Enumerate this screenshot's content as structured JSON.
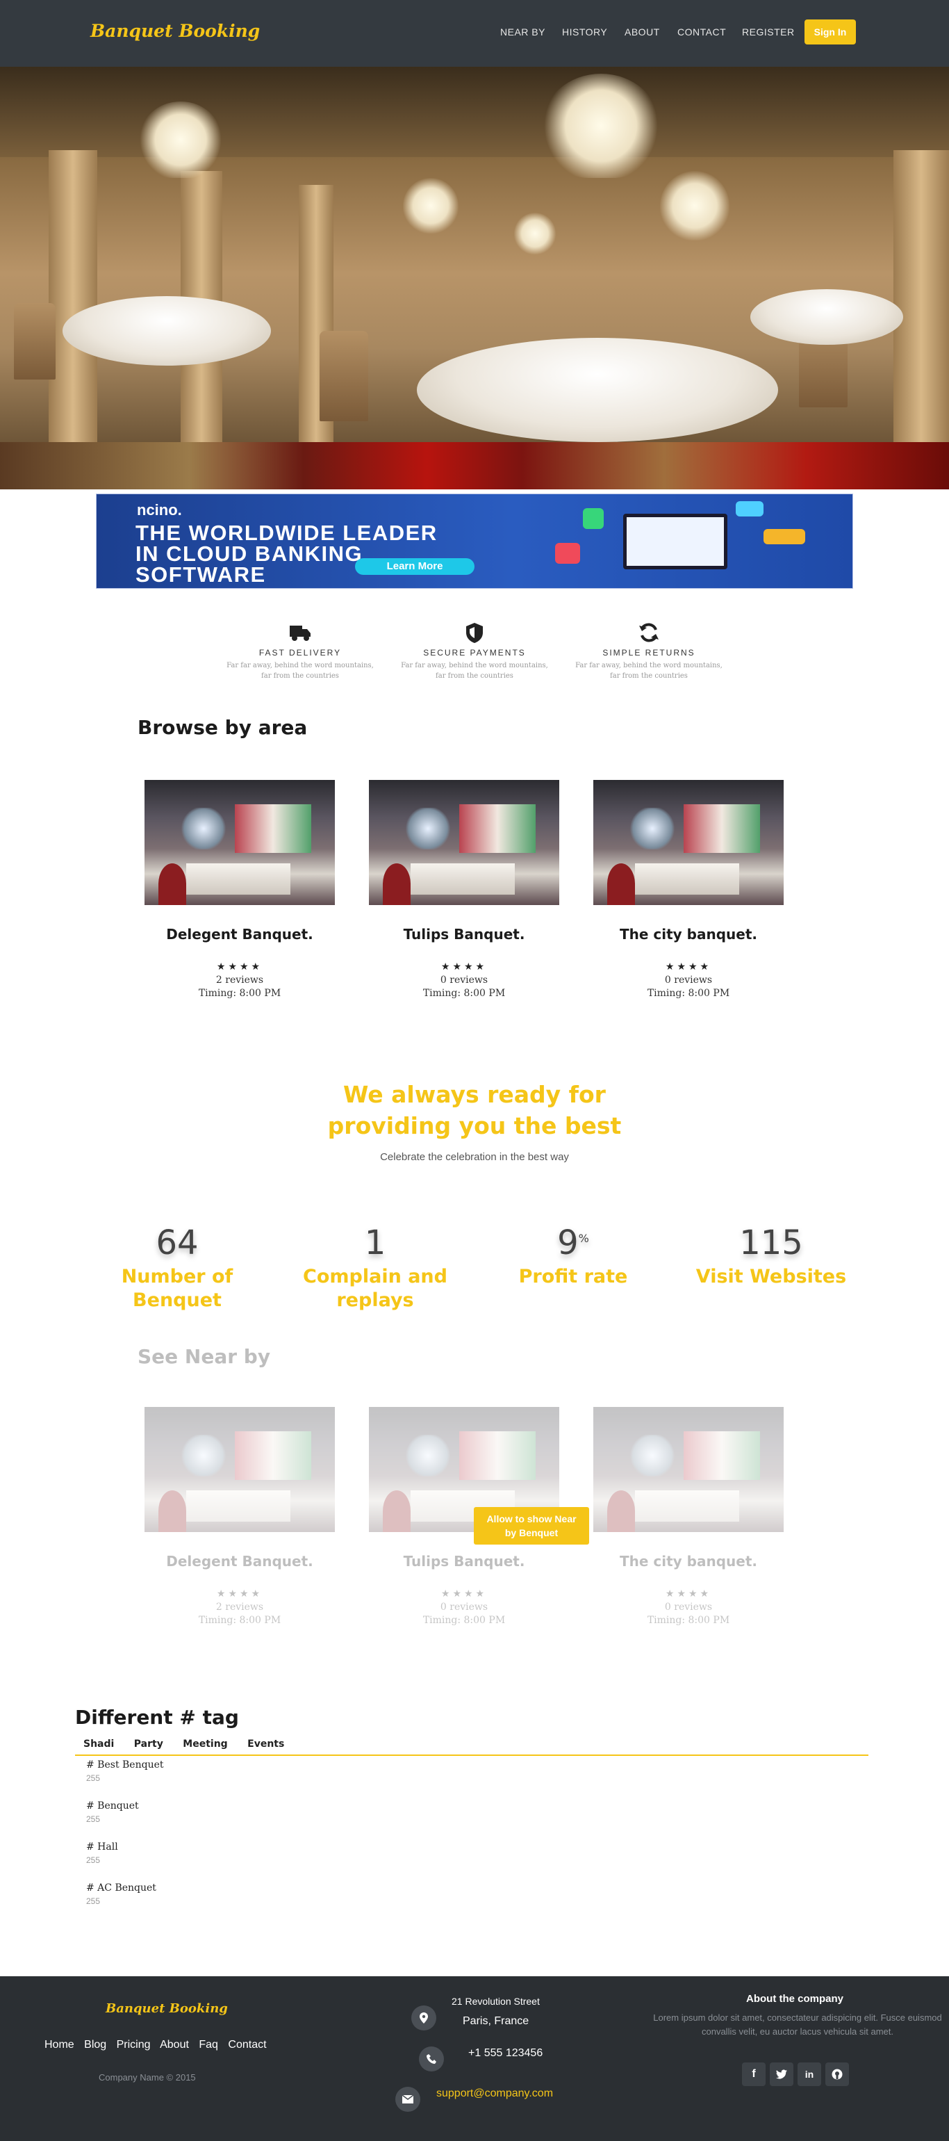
{
  "header": {
    "brand": "Banquet Booking",
    "nav": [
      "NEAR BY",
      "HISTORY",
      "ABOUT",
      "CONTACT",
      "REGISTER"
    ],
    "signin": "Sign In"
  },
  "ad": {
    "logo": "ncino.",
    "line1": "THE WORLDWIDE LEADER",
    "line2": "IN CLOUD BANKING",
    "line3": "SOFTWARE",
    "button": "Learn More"
  },
  "features": [
    {
      "title": "FAST DELIVERY",
      "desc": "Far far away, behind the word mountains, far from the countries",
      "icon": "truck-icon"
    },
    {
      "title": "SECURE PAYMENTS",
      "desc": "Far far away, behind the word mountains, far from the countries",
      "icon": "shield-icon"
    },
    {
      "title": "SIMPLE RETURNS",
      "desc": "Far far away, behind the word mountains, far from the countries",
      "icon": "refresh-icon"
    }
  ],
  "browse": {
    "title": "Browse by area",
    "cards": [
      {
        "name": "Delegent Banquet.",
        "stars": "★★★★",
        "reviews": "2 reviews",
        "timing": "Timing: 8:00 PM"
      },
      {
        "name": "Tulips Banquet.",
        "stars": "★★★★",
        "reviews": "0 reviews",
        "timing": "Timing: 8:00 PM"
      },
      {
        "name": "The city banquet.",
        "stars": "★★★★",
        "reviews": "0 reviews",
        "timing": "Timing: 8:00 PM"
      }
    ]
  },
  "ready": {
    "line1": "We always ready for",
    "line2": "providing you the best",
    "subtitle": "Celebrate the celebration in the best way"
  },
  "stats": [
    {
      "number": "64",
      "suffix": "",
      "label1": "Number of",
      "label2": "Benquet"
    },
    {
      "number": "1",
      "suffix": "",
      "label1": "Complain and",
      "label2": "replays"
    },
    {
      "number": "9",
      "suffix": "%",
      "label1": "Profit rate",
      "label2": ""
    },
    {
      "number": "115",
      "suffix": "",
      "label1": "Visit Websites",
      "label2": ""
    }
  ],
  "nearby": {
    "title": "See Near by",
    "allow_line1": "Allow to show Near",
    "allow_line2": "by Benquet",
    "cards": [
      {
        "name": "Delegent Banquet.",
        "stars": "★★★★",
        "reviews": "2 reviews",
        "timing": "Timing: 8:00 PM"
      },
      {
        "name": "Tulips Banquet.",
        "stars": "★★★★",
        "reviews": "0 reviews",
        "timing": "Timing: 8:00 PM"
      },
      {
        "name": "The city banquet.",
        "stars": "★★★★",
        "reviews": "0 reviews",
        "timing": "Timing: 8:00 PM"
      }
    ]
  },
  "tags": {
    "title": "Different # tag",
    "tabs": [
      "Shadi",
      "Party",
      "Meeting",
      "Events"
    ],
    "items": [
      {
        "name": "# Best Benquet",
        "count": "255"
      },
      {
        "name": "# Benquet",
        "count": "255"
      },
      {
        "name": "# Hall",
        "count": "255"
      },
      {
        "name": "# AC Benquet",
        "count": "255"
      }
    ]
  },
  "footer": {
    "brand": "Banquet Booking",
    "links": [
      "Home",
      "Blog",
      "Pricing",
      "About",
      "Faq",
      "Contact"
    ],
    "copyright": "Company Name © 2015",
    "address1": "21 Revolution Street",
    "address2": "Paris, France",
    "phone": "+1 555 123456",
    "email": "support@company.com",
    "about_title": "About the company",
    "about_text": "Lorem ipsum dolor sit amet, consectateur adispicing elit. Fusce euismod convallis velit, eu auctor lacus vehicula sit amet."
  },
  "colors": {
    "accent": "#f5c518",
    "header_bg": "#343a40",
    "footer_bg": "#2b2f33"
  }
}
